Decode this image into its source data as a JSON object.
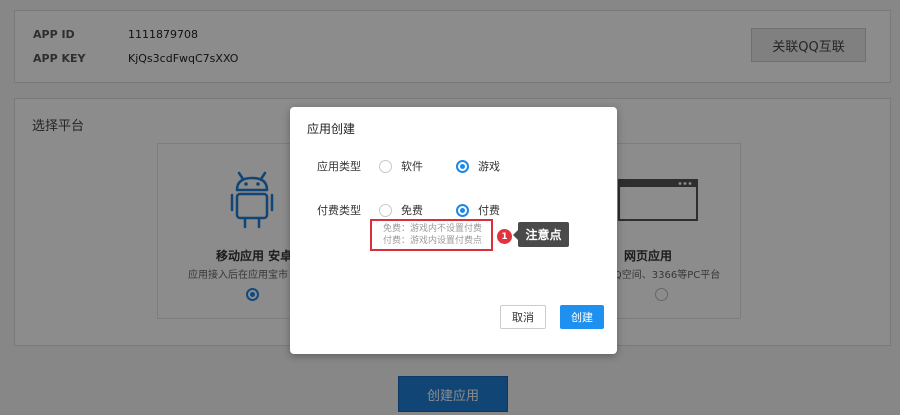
{
  "app_info": {
    "app_id_label": "APP ID",
    "app_id_value": "1111879708",
    "app_key_label": "APP KEY",
    "app_key_value": "KjQs3cdFwqC7sXXO",
    "link_qq_button": "关联QQ互联"
  },
  "platform_section": {
    "title": "选择平台",
    "mobile": {
      "name": "移动应用 安卓",
      "desc": "应用接入后在应用宝市",
      "icon": "android-icon",
      "selected": true
    },
    "web": {
      "name": "网页应用",
      "desc": "QQ空间、3366等PC平台",
      "icon": "browser-window-icon",
      "selected": false
    }
  },
  "create_app_button": "创建应用",
  "modal": {
    "title": "应用创建",
    "app_type_label": "应用类型",
    "app_type_options": [
      {
        "label": "软件",
        "selected": false
      },
      {
        "label": "游戏",
        "selected": true
      }
    ],
    "pay_type_label": "付费类型",
    "pay_type_options": [
      {
        "label": "免费",
        "selected": false
      },
      {
        "label": "付费",
        "selected": true
      }
    ],
    "notes": [
      "免费：游戏内不设置付费",
      "付费：游戏内设置付费点"
    ],
    "cancel_button": "取消",
    "create_button": "创建"
  },
  "annotation": {
    "badge_number": "1",
    "callout_text": "注意点"
  },
  "colors": {
    "accent": "#1e88e5",
    "highlight": "#d9303b",
    "callout_bg": "#4a4a4a"
  }
}
